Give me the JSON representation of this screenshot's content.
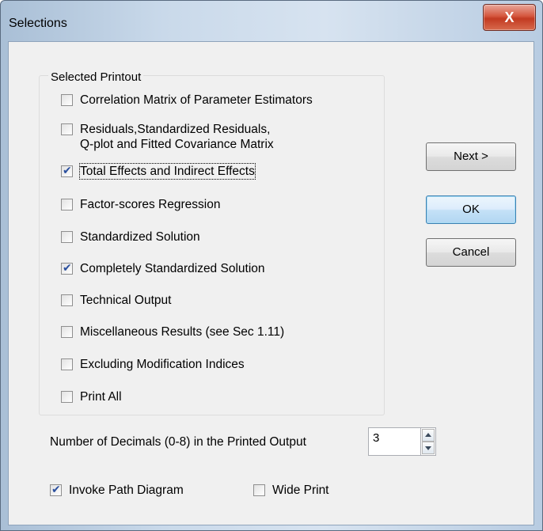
{
  "window": {
    "title": "Selections",
    "close_glyph": "X"
  },
  "group": {
    "label": "Selected Printout",
    "items": [
      {
        "label": "Correlation Matrix of Parameter Estimators",
        "checked": false
      },
      {
        "label": "Residuals,Standardized Residuals,",
        "label2": "Q-plot and Fitted Covariance Matrix",
        "checked": false
      },
      {
        "label": "Total Effects and Indirect Effects",
        "checked": true
      },
      {
        "label": "Factor-scores Regression",
        "checked": false
      },
      {
        "label": "Standardized Solution",
        "checked": false
      },
      {
        "label": "Completely Standardized Solution",
        "checked": true
      },
      {
        "label": "Technical Output",
        "checked": false
      },
      {
        "label": "Miscellaneous Results (see Sec 1.11)",
        "checked": false
      },
      {
        "label": "Excluding Modification Indices",
        "checked": false
      },
      {
        "label": "Print All",
        "checked": false
      }
    ]
  },
  "buttons": {
    "next": "Next >",
    "ok": "OK",
    "cancel": "Cancel"
  },
  "decimals": {
    "label": "Number of Decimals (0-8) in the Printed Output",
    "value": "3"
  },
  "options": {
    "invoke_path_diagram": {
      "label": "Invoke Path Diagram",
      "checked": true
    },
    "wide_print": {
      "label": "Wide Print",
      "checked": false
    }
  }
}
